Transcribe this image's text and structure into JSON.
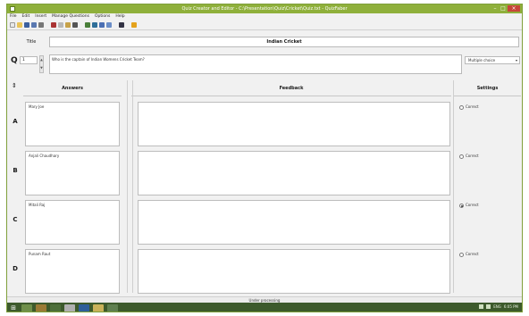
{
  "window": {
    "title": "Quiz Creator and Editor - C:\\Presentation\\Quiz\\Cricket\\Quiz.txt - QuizFaber",
    "buttons": [
      "minimize",
      "maximize",
      "close"
    ]
  },
  "menu": [
    "File",
    "Edit",
    "Insert",
    "Manage Questions",
    "Options",
    "Help"
  ],
  "toolbar_icons": [
    "new-icon",
    "open-icon",
    "save-icon",
    "save-as-icon",
    "print-icon",
    "cut-icon",
    "copy-icon",
    "paste-icon",
    "delete-icon",
    "undo-icon",
    "add-question-icon",
    "remove-question-icon",
    "settings-icon",
    "run-icon",
    "help-icon"
  ],
  "title_label": "Title",
  "title_value": "Indian Cricket",
  "question": {
    "icon": "Q",
    "number": "1",
    "text": "Who is the captain of Indian Womens Cricket Team?",
    "type": "Multiple choice"
  },
  "columns": {
    "answers": "Answers",
    "feedback": "Feedback",
    "settings": "Settings"
  },
  "answers": [
    {
      "letter": "A",
      "text": "Mary Joe",
      "setting": "Correct",
      "checked": false
    },
    {
      "letter": "B",
      "text": "Anjali Chaudhary",
      "setting": "Correct",
      "checked": false
    },
    {
      "letter": "C",
      "text": "Mitali Raj",
      "setting": "Correct",
      "checked": true
    },
    {
      "letter": "D",
      "text": "Punam Raut",
      "setting": "Correct",
      "checked": false
    }
  ],
  "status": "Under processing",
  "taskbar": {
    "time": "6:05 PM",
    "lang": "ENG"
  },
  "colors": {
    "titlebar": "#8fb03b",
    "taskbar": "#3d5a2c",
    "close": "#c7463a"
  }
}
